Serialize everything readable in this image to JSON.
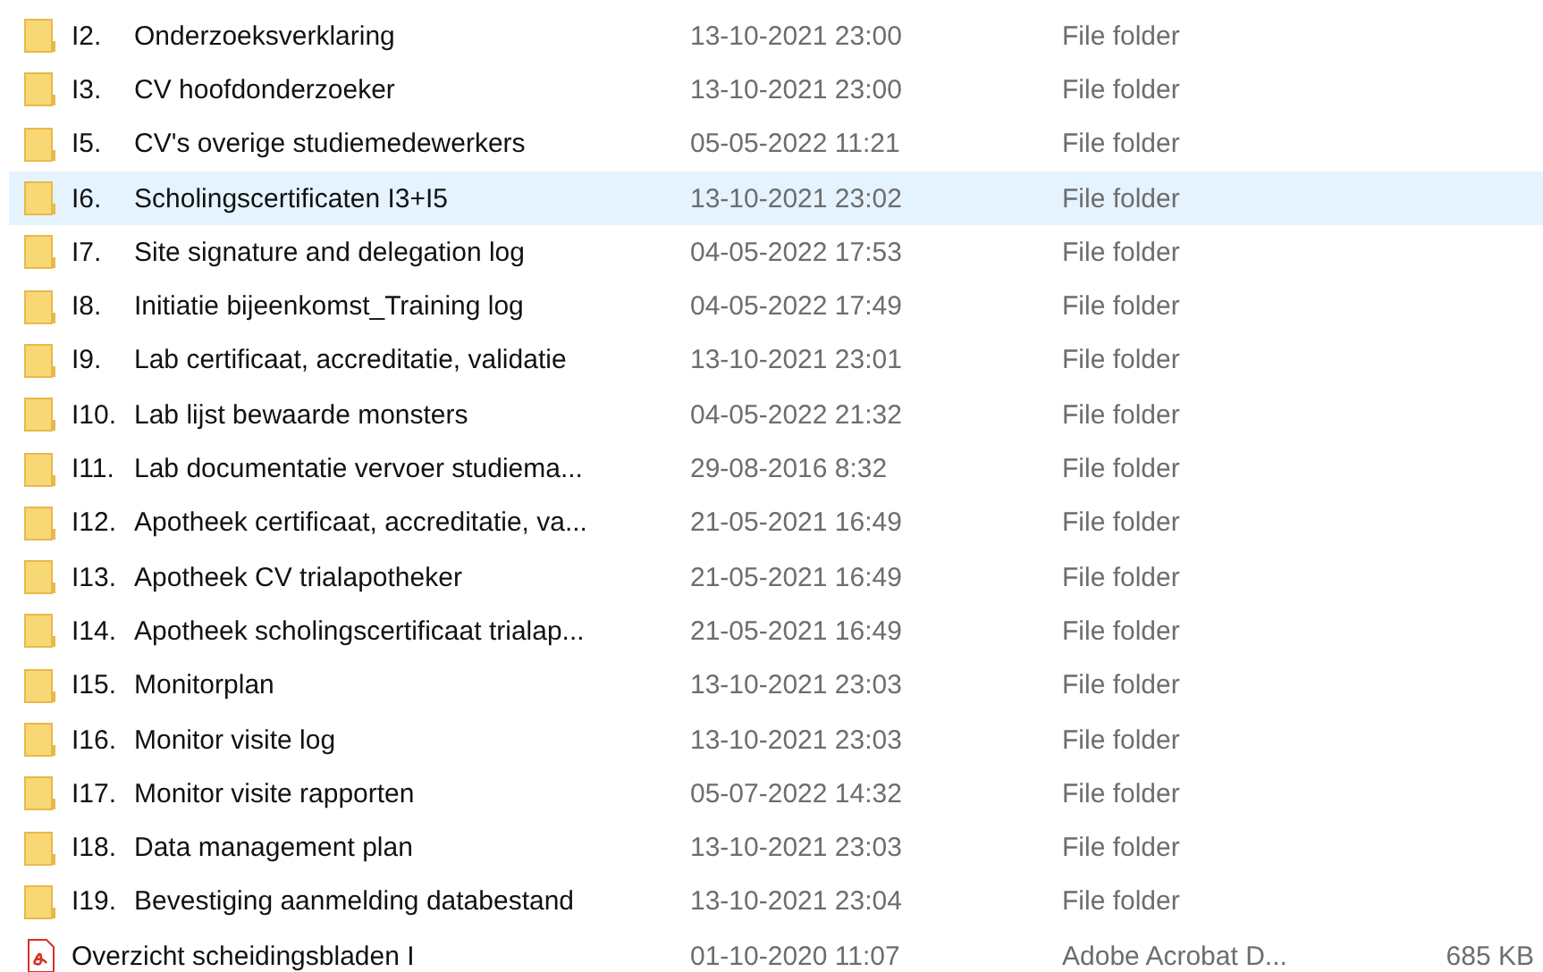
{
  "files": [
    {
      "kind": "folder",
      "number": "I2.",
      "name": "Onderzoeksverklaring",
      "modified": "13-10-2021 23:00",
      "type": "File folder",
      "selected": false
    },
    {
      "kind": "folder",
      "number": "I3.",
      "name": "CV hoofdonderzoeker",
      "modified": "13-10-2021 23:00",
      "type": "File folder",
      "selected": false
    },
    {
      "kind": "folder",
      "number": "I5.",
      "name": "CV's overige studiemedewerkers",
      "modified": "05-05-2022 11:21",
      "type": "File folder",
      "selected": false
    },
    {
      "kind": "folder",
      "number": "I6.",
      "name": "Scholingscertificaten I3+I5",
      "modified": "13-10-2021 23:02",
      "type": "File folder",
      "selected": true
    },
    {
      "kind": "folder",
      "number": "I7.",
      "name": "Site signature and delegation log",
      "modified": "04-05-2022 17:53",
      "type": "File folder",
      "selected": false
    },
    {
      "kind": "folder",
      "number": "I8.",
      "name": "Initiatie bijeenkomst_Training log",
      "modified": "04-05-2022 17:49",
      "type": "File folder",
      "selected": false
    },
    {
      "kind": "folder",
      "number": "I9.",
      "name": "Lab certificaat, accreditatie, validatie",
      "modified": "13-10-2021 23:01",
      "type": "File folder",
      "selected": false
    },
    {
      "kind": "folder",
      "number": "I10.",
      "name": "Lab lijst bewaarde monsters",
      "modified": "04-05-2022 21:32",
      "type": "File folder",
      "selected": false
    },
    {
      "kind": "folder",
      "number": "I11.",
      "name": "Lab documentatie vervoer studiema...",
      "modified": "29-08-2016 8:32",
      "type": "File folder",
      "selected": false
    },
    {
      "kind": "folder",
      "number": "I12.",
      "name": "Apotheek certificaat, accreditatie, va...",
      "modified": "21-05-2021 16:49",
      "type": "File folder",
      "selected": false
    },
    {
      "kind": "folder",
      "number": "I13.",
      "name": "Apotheek CV trialapotheker",
      "modified": "21-05-2021 16:49",
      "type": "File folder",
      "selected": false
    },
    {
      "kind": "folder",
      "number": "I14.",
      "name": "Apotheek scholingscertificaat trialap...",
      "modified": "21-05-2021 16:49",
      "type": "File folder",
      "selected": false
    },
    {
      "kind": "folder",
      "number": "I15.",
      "name": "Monitorplan",
      "modified": "13-10-2021 23:03",
      "type": "File folder",
      "selected": false
    },
    {
      "kind": "folder",
      "number": "I16.",
      "name": "Monitor visite log",
      "modified": "13-10-2021 23:03",
      "type": "File folder",
      "selected": false
    },
    {
      "kind": "folder",
      "number": "I17.",
      "name": "Monitor visite rapporten",
      "modified": "05-07-2022 14:32",
      "type": "File folder",
      "selected": false
    },
    {
      "kind": "folder",
      "number": "I18.",
      "name": "Data management plan",
      "modified": "13-10-2021 23:03",
      "type": "File folder",
      "selected": false
    },
    {
      "kind": "folder",
      "number": "I19.",
      "name": "Bevestiging aanmelding databestand",
      "modified": "13-10-2021 23:04",
      "type": "File folder",
      "selected": false
    },
    {
      "kind": "pdf",
      "name": "Overzicht scheidingsbladen I",
      "modified": "01-10-2020 11:07",
      "type": "Adobe Acrobat D...",
      "size": "685 KB",
      "selected": false
    }
  ]
}
